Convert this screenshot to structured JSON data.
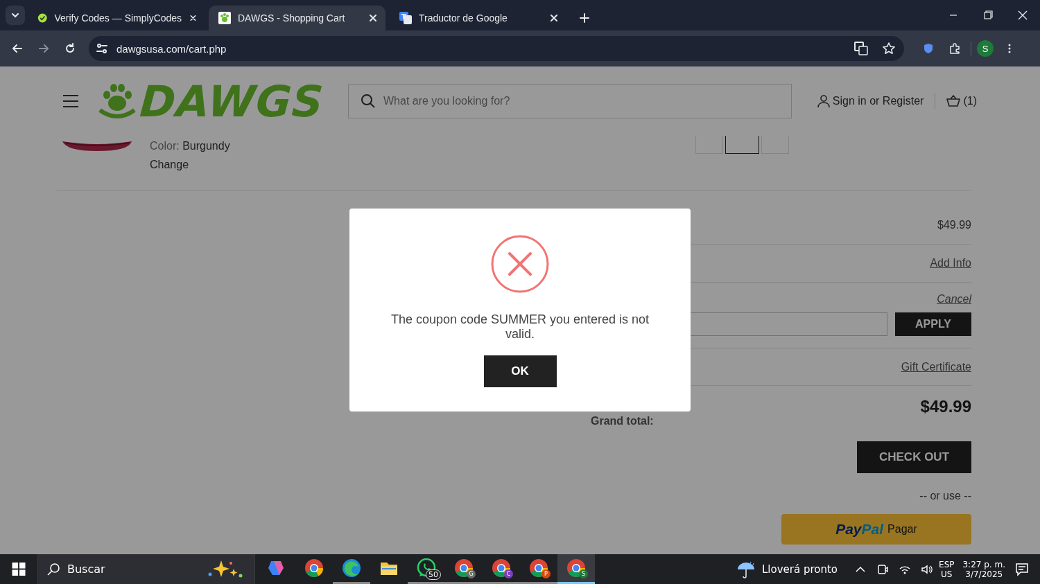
{
  "browser": {
    "tabs": [
      {
        "title": "Verify Codes — SimplyCodes",
        "kind": "check",
        "selected": false
      },
      {
        "title": "DAWGS - Shopping Cart",
        "kind": "paw",
        "selected": true
      },
      {
        "title": "Traductor de Google",
        "kind": "translate",
        "selected": false
      }
    ],
    "address": "dawgsusa.com/cart.php",
    "profile": "S"
  },
  "header": {
    "logo": "DAWGS",
    "search": {
      "placeholder": "What are you looking for?"
    },
    "sign_in": "Sign in or Register",
    "cart_count": "(1)"
  },
  "cart_item": {
    "color_label": "Color:",
    "color_value": "Burgundy",
    "change": "Change"
  },
  "summary": {
    "subtotal": "$49.99",
    "add_info": "Add Info",
    "cancel": "Cancel",
    "apply": "APPLY",
    "gift_certificate": "Gift Certificate",
    "grand_total_label": "Grand total:",
    "grand_total": "$49.99",
    "checkout": "CHECK OUT",
    "or_use": "-- or use --",
    "paypal": {
      "logo": [
        "Pay",
        "Pal"
      ],
      "label": "Pagar"
    }
  },
  "modal": {
    "message": "The coupon code SUMMER you entered is not valid.",
    "button": "OK"
  },
  "taskbar": {
    "search": "Buscar",
    "apps": [
      {
        "kind": "copilot",
        "running": false,
        "selected": false
      },
      {
        "kind": "chrome",
        "running": false,
        "selected": false
      },
      {
        "kind": "edge",
        "running": true,
        "selected": false
      },
      {
        "kind": "folder",
        "running": false,
        "selected": false
      },
      {
        "kind": "whatsapp",
        "badge": "50",
        "running": true,
        "selected": false
      },
      {
        "kind": "chrome",
        "letter": "G",
        "running": true,
        "selected": false
      },
      {
        "kind": "chrome",
        "letter": "C",
        "running": true,
        "selected": false
      },
      {
        "kind": "chrome",
        "letter": "P",
        "running": true,
        "selected": false
      },
      {
        "kind": "chrome",
        "letter": "S",
        "running": true,
        "selected": true
      }
    ],
    "weather": "Lloverá pronto",
    "language": [
      "ESP",
      "US"
    ],
    "time": "3:27 p. m.",
    "date": "3/7/2025"
  }
}
